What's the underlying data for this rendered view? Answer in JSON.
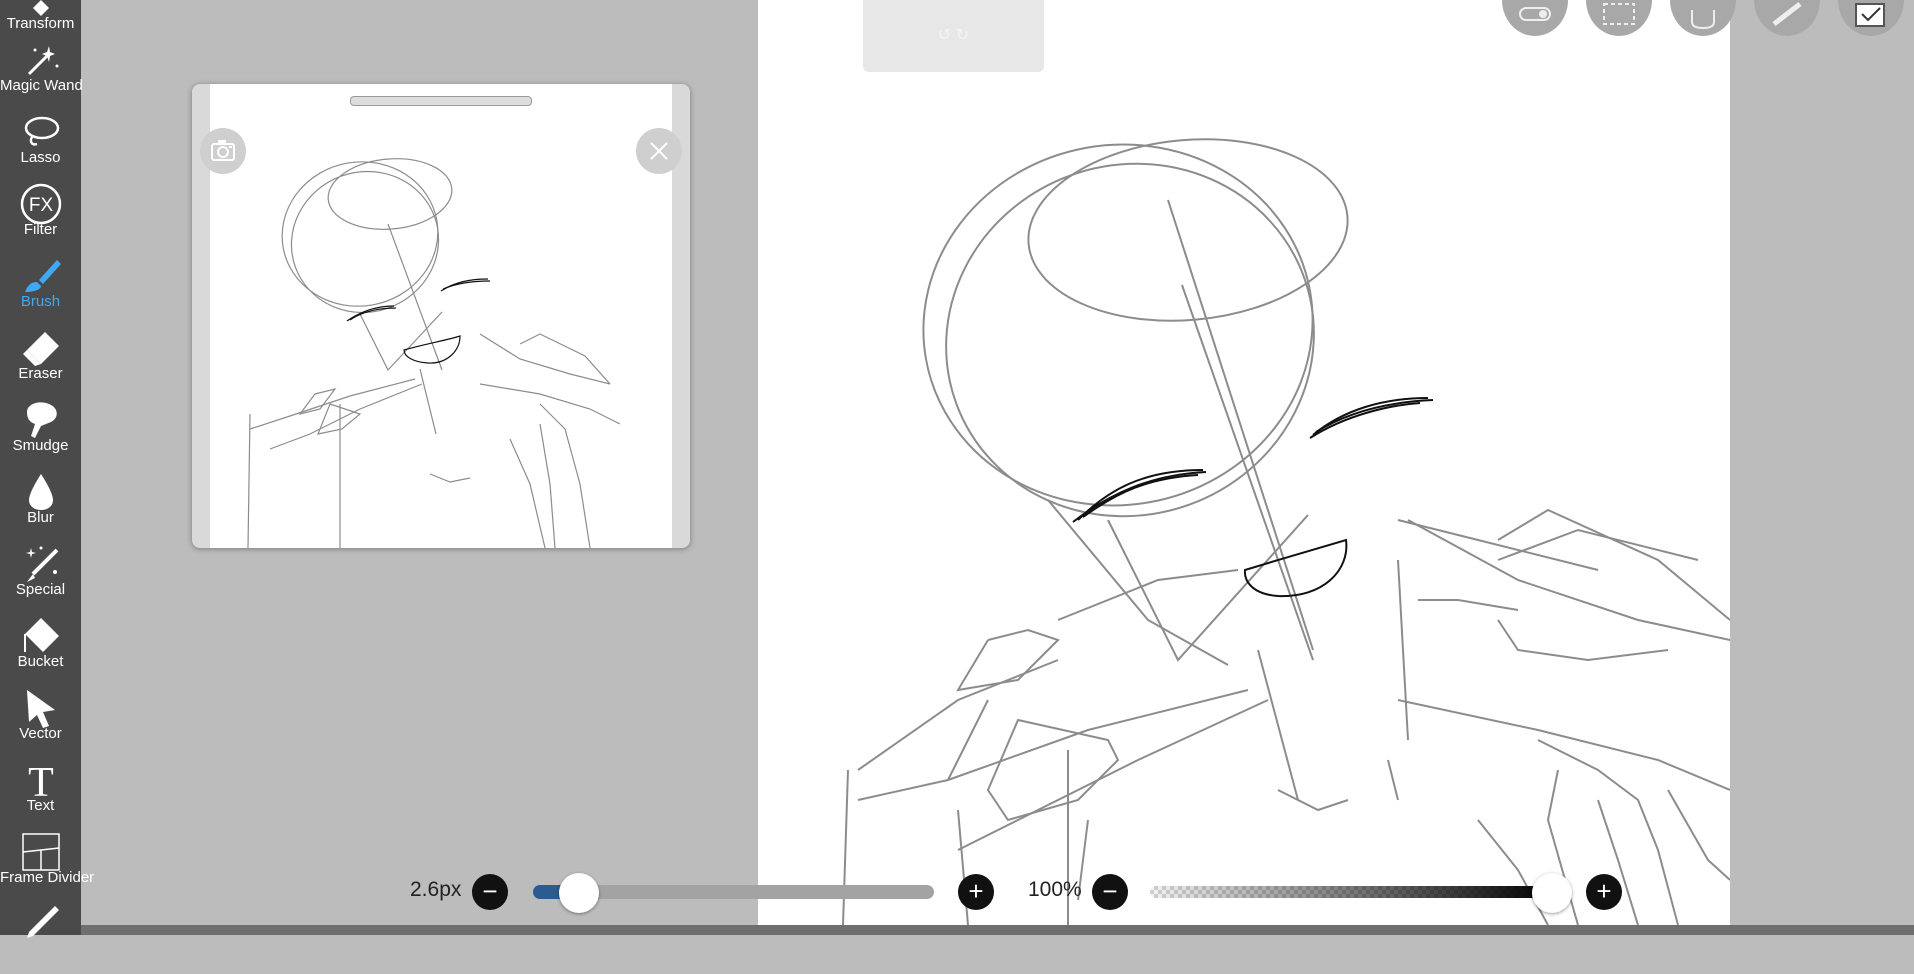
{
  "toolbar": {
    "items": [
      {
        "label": "Transform",
        "icon": "transform-icon",
        "active": false
      },
      {
        "label": "Magic Wand",
        "icon": "magic-wand-icon",
        "active": false
      },
      {
        "label": "Lasso",
        "icon": "lasso-icon",
        "active": false
      },
      {
        "label": "Filter",
        "icon": "fx-filter-icon",
        "active": false,
        "glyph": "FX"
      },
      {
        "label": "Brush",
        "icon": "brush-icon",
        "active": true
      },
      {
        "label": "Eraser",
        "icon": "eraser-icon",
        "active": false
      },
      {
        "label": "Smudge",
        "icon": "smudge-icon",
        "active": false
      },
      {
        "label": "Blur",
        "icon": "blur-drop-icon",
        "active": false
      },
      {
        "label": "Special",
        "icon": "special-brush-icon",
        "active": false
      },
      {
        "label": "Bucket",
        "icon": "bucket-icon",
        "active": false
      },
      {
        "label": "Vector",
        "icon": "vector-arrow-icon",
        "active": false
      },
      {
        "label": "Text",
        "icon": "text-icon",
        "active": false,
        "glyph": "T"
      },
      {
        "label": "Frame Divider",
        "icon": "frame-divider-icon",
        "active": false
      },
      {
        "label": "",
        "icon": "eyedropper-icon",
        "active": false
      }
    ],
    "active_color": "#3fa9f5"
  },
  "reference_popup": {
    "camera_icon": "camera-icon",
    "close_icon": "close-icon"
  },
  "top_bar": {
    "undo_redo_text": "↺ ↻",
    "tools": [
      "toggle-icon",
      "selection-icon",
      "hand-icon",
      "ruler-icon",
      "layer-icon"
    ]
  },
  "brush_size": {
    "value_label": "2.6px",
    "minus": "−",
    "plus": "+",
    "level": 0.07
  },
  "opacity": {
    "value_label": "100%",
    "minus": "−",
    "plus": "+",
    "level": 1.0
  },
  "colors": {
    "toolbar_bg": "#4a4a4a",
    "workspace_bg": "#bcbcbc",
    "canvas_bg": "#ffffff",
    "accent": "#3fa9f5",
    "slider_fill": "#2b5c8f"
  }
}
